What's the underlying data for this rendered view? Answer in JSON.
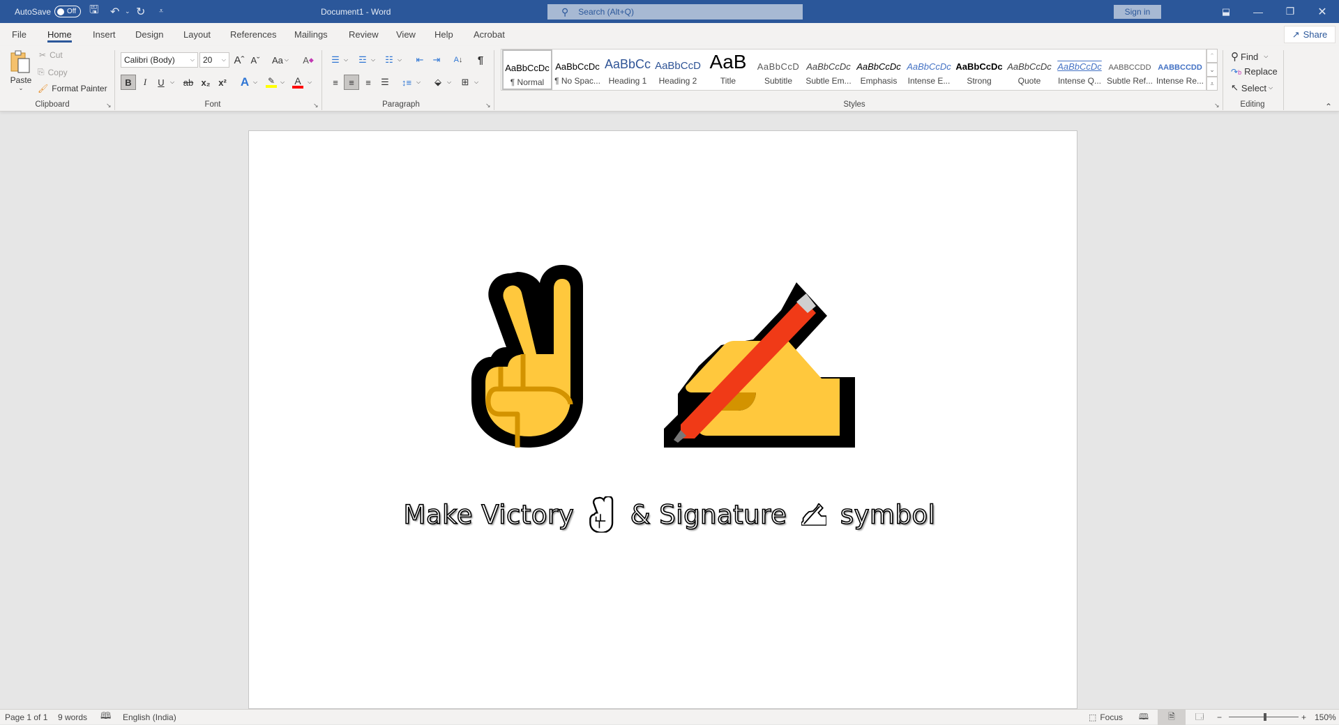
{
  "titlebar": {
    "autosave_label": "AutoSave",
    "autosave_state": "Off",
    "document_title": "Document1  -  Word",
    "search_placeholder": "Search (Alt+Q)",
    "signin_label": "Sign in",
    "accent_color": "#2b579a"
  },
  "tabs": [
    {
      "label": "File"
    },
    {
      "label": "Home",
      "active": true
    },
    {
      "label": "Insert"
    },
    {
      "label": "Design"
    },
    {
      "label": "Layout"
    },
    {
      "label": "References"
    },
    {
      "label": "Mailings"
    },
    {
      "label": "Review"
    },
    {
      "label": "View"
    },
    {
      "label": "Help"
    },
    {
      "label": "Acrobat"
    }
  ],
  "share_label": "Share",
  "ribbon": {
    "clipboard": {
      "label": "Clipboard",
      "paste": "Paste",
      "cut": "Cut",
      "copy": "Copy",
      "format_painter": "Format Painter"
    },
    "font": {
      "label": "Font",
      "font_name": "Calibri (Body)",
      "font_size": "20",
      "change_case": "Aa",
      "bold": "B",
      "italic": "I",
      "underline": "U",
      "strikethrough": "ab",
      "subscript": "x₂",
      "superscript": "x²",
      "highlight_color": "#ffff00",
      "font_color": "#ff0000"
    },
    "paragraph": {
      "label": "Paragraph",
      "pilcrow": "¶"
    },
    "styles": {
      "label": "Styles",
      "items": [
        {
          "preview": "AaBbCcDc",
          "name": "¶ Normal",
          "selected": true
        },
        {
          "preview": "AaBbCcDc",
          "name": "¶ No Spac..."
        },
        {
          "preview": "AaBbCc",
          "name": "Heading 1"
        },
        {
          "preview": "AaBbCcD",
          "name": "Heading 2"
        },
        {
          "preview": "AaB",
          "name": "Title"
        },
        {
          "preview": "AaBbCcD",
          "name": "Subtitle"
        },
        {
          "preview": "AaBbCcDc",
          "name": "Subtle Em..."
        },
        {
          "preview": "AaBbCcDc",
          "name": "Emphasis"
        },
        {
          "preview": "AaBbCcDc",
          "name": "Intense E..."
        },
        {
          "preview": "AaBbCcDc",
          "name": "Strong"
        },
        {
          "preview": "AaBbCcDc",
          "name": "Quote"
        },
        {
          "preview": "AaBbCcDc",
          "name": "Intense Q..."
        },
        {
          "preview": "AABBCCDD",
          "name": "Subtle Ref..."
        },
        {
          "preview": "AABBCCDD",
          "name": "Intense Re..."
        }
      ]
    },
    "editing": {
      "label": "Editing",
      "find": "Find",
      "replace": "Replace",
      "select": "Select"
    }
  },
  "document": {
    "text_parts": [
      "Make Victory",
      "& Signature",
      "symbol"
    ],
    "emoji_victory": "victory-hand",
    "emoji_writing": "writing-hand"
  },
  "statusbar": {
    "page": "Page 1 of 1",
    "words": "9 words",
    "language": "English (India)",
    "focus": "Focus",
    "zoom": "150%"
  }
}
